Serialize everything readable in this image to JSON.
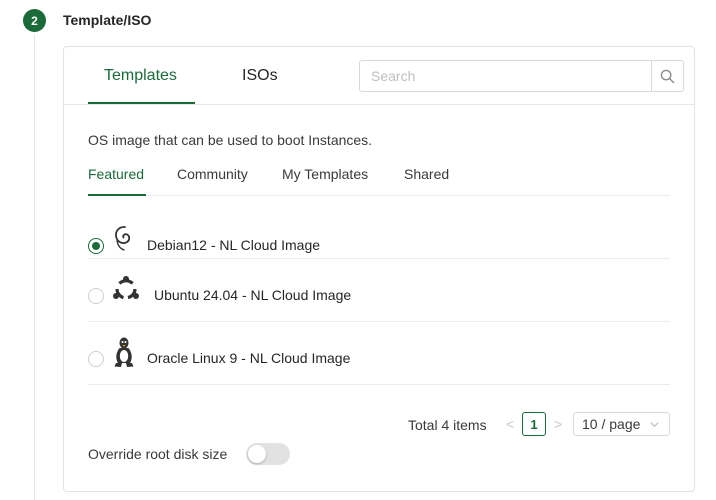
{
  "step": {
    "number": "2",
    "title": "Template/ISO"
  },
  "main_tabs": [
    {
      "label": "Templates",
      "active": true
    },
    {
      "label": "ISOs",
      "active": false
    }
  ],
  "search": {
    "placeholder": "Search",
    "value": "",
    "icon": "search-icon"
  },
  "description": "OS image that can be used to boot Instances.",
  "sub_tabs": [
    {
      "label": "Featured",
      "active": true
    },
    {
      "label": "Community",
      "active": false
    },
    {
      "label": "My Templates",
      "active": false
    },
    {
      "label": "Shared",
      "active": false
    }
  ],
  "images": [
    {
      "label": "Debian12 - NL Cloud Image",
      "icon": "debian-icon",
      "selected": true
    },
    {
      "label": "Ubuntu 24.04 - NL Cloud Image",
      "icon": "ubuntu-icon",
      "selected": false
    },
    {
      "label": "Oracle Linux 9 - NL Cloud Image",
      "icon": "linux-tux-icon",
      "selected": false
    }
  ],
  "pagination": {
    "total": "Total 4 items",
    "prev": "<",
    "next": ">",
    "current_page": "1",
    "page_size": "10 / page"
  },
  "override_root_disk": {
    "label": "Override root disk size",
    "enabled": false
  },
  "colors": {
    "accent": "#1b6b3a",
    "border": "#e3e3e3",
    "text": "#262626"
  }
}
